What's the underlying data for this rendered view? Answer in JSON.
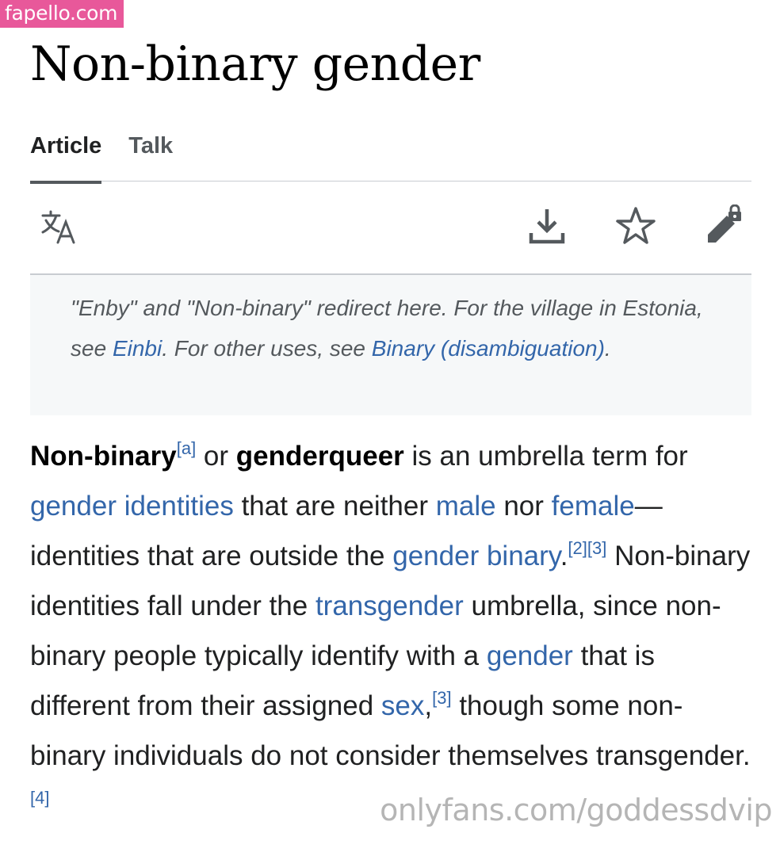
{
  "watermark_top": "fapello.com",
  "watermark_bottom": "onlyfans.com/goddessdvip",
  "page_title": "Non-binary gender",
  "tabs": [
    {
      "label": "Article",
      "active": true
    },
    {
      "label": "Talk",
      "active": false
    }
  ],
  "toolbar": {
    "icons": [
      "language-icon",
      "download-icon",
      "star-icon",
      "edit-lock-icon"
    ]
  },
  "hatnote": {
    "text1": "\"Enby\" and \"Non-binary\" redirect here. For the village in Estonia, see ",
    "link1": "Einbi",
    "text2": ". For other uses, see ",
    "link2": "Binary (disambiguation)",
    "text3": "."
  },
  "lead": {
    "term1": "Non-binary",
    "ref_a": "[a]",
    "or": " or ",
    "term2": "genderqueer",
    "t1": " is an umbrella term for ",
    "link_gender_identities": "gender identities",
    "t2": " that are neither ",
    "link_male": "male",
    "t3": " nor ",
    "link_female": "female",
    "t4": "—identities that are outside the ",
    "link_gender_binary": "gender binary",
    "t5": ".",
    "ref_2_3": "[2][3]",
    "t6": " Non-binary identities fall under the ",
    "link_transgender": "transgender",
    "t7": " umbrella, since non-binary people typically identify with a ",
    "link_gender": "gender",
    "t8": " that is different from their assigned ",
    "link_sex": "sex",
    "t9": ",",
    "ref_3": "[3]",
    "t10": " though some non-binary individuals do not consider themselves transgender.",
    "ref_4": "[4]"
  },
  "colors": {
    "link": "#3366aa",
    "text": "#202122",
    "watermark_bg": "#e8589a",
    "hatnote_bg": "#f6f8f9"
  }
}
